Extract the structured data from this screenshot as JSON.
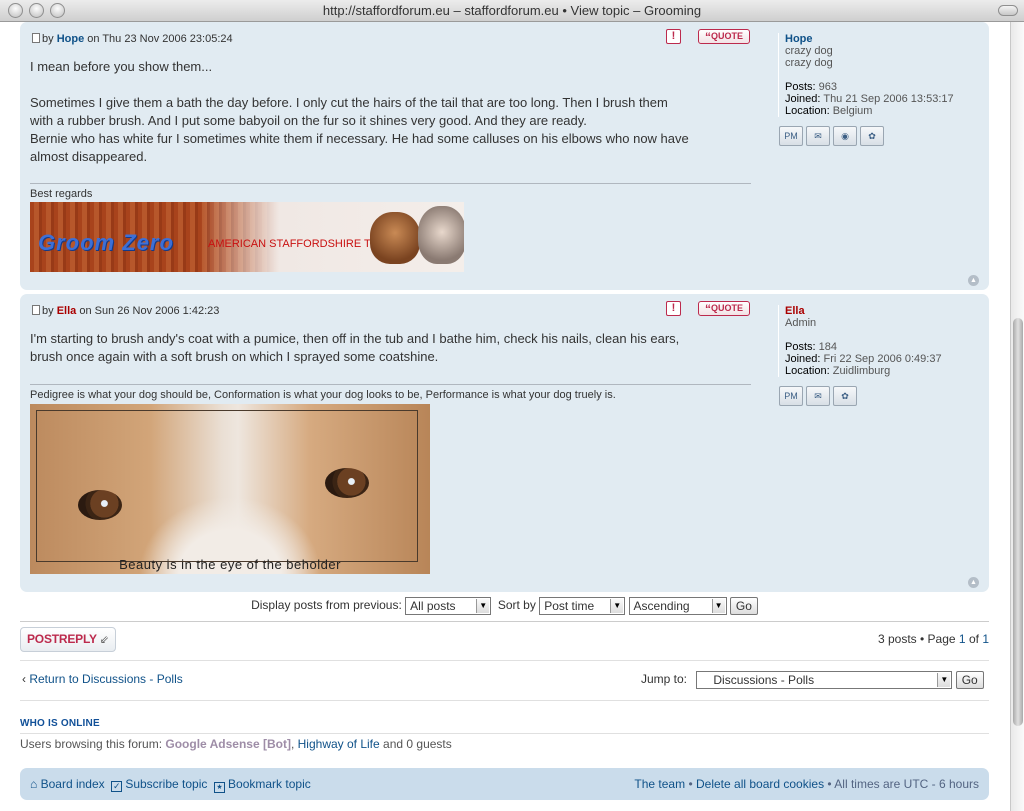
{
  "window": {
    "title": "http://staffordforum.eu – staffordforum.eu • View topic – Grooming"
  },
  "posts": [
    {
      "author_prefix": "by",
      "author": "Hope",
      "date": "on Thu 23 Nov 2006 23:05:24",
      "quote_label": "QUOTE",
      "report_label": "!",
      "content": [
        "I mean before you show them...",
        "",
        "Sometimes I give them a bath the day before. I only cut the hairs of the tail that are too long. Then I brush them",
        "with a rubber brush. And I put some babyoil on the fur so it shines very good. And they are ready.",
        "Bernie who has white fur I sometimes white them if necessary. He had some calluses on his elbows who now have",
        "almost disappeared."
      ],
      "signature_text": "Best regards",
      "banner_logo": "Groom Zero",
      "banner_kennel": "AMERICAN STAFFORDSHIRE TERRIER KENNEL",
      "profile": {
        "name": "Hope",
        "rank1": "crazy dog",
        "rank2": "crazy dog",
        "posts_label": "Posts:",
        "posts": "963",
        "joined_label": "Joined:",
        "joined": "Thu 21 Sep 2006 13:53:17",
        "location_label": "Location:",
        "location": "Belgium"
      }
    },
    {
      "author_prefix": "by",
      "author": "Ella",
      "date": "on Sun 26 Nov 2006 1:42:23",
      "quote_label": "QUOTE",
      "report_label": "!",
      "content": [
        "I'm starting to brush andy's coat with a pumice, then off in the tub and I bathe him, check his nails, clean his ears,",
        "brush once again with a soft brush on which I sprayed some coatshine."
      ],
      "signature_text": "Pedigree is what your dog should be, Conformation is what your dog looks to be, Performance is what your dog truely is.",
      "image_caption": "Beauty is in the eye of the beholder",
      "profile": {
        "name": "Ella",
        "rank1": "Admin",
        "posts_label": "Posts:",
        "posts": "184",
        "joined_label": "Joined:",
        "joined": "Fri 22 Sep 2006 0:49:37",
        "location_label": "Location:",
        "location": "Zuidlimburg"
      }
    }
  ],
  "profile_icons": {
    "pm": "PM",
    "email": "✉",
    "www": "◉",
    "icq": "✿"
  },
  "display": {
    "label": "Display posts from previous:",
    "range": "All posts",
    "sort_label": "Sort by",
    "sort": "Post time",
    "order": "Ascending",
    "go": "Go"
  },
  "postreply": {
    "label": "POSTREPLY",
    "icon": "⇙"
  },
  "pagination": {
    "posts": "3 posts",
    "page_prefix": "• Page",
    "current": "1",
    "of": "of",
    "total": "1"
  },
  "nav": {
    "return_icon": "‹",
    "return": "Return to Discussions - Polls",
    "jump_label": "Jump to:",
    "jump_value": "Discussions - Polls",
    "go": "Go"
  },
  "online": {
    "title": "WHO IS ONLINE",
    "prefix": "Users browsing this forum:",
    "bot": "Google Adsense [Bot]",
    "sep": ",",
    "user": "Highway of Life",
    "suffix": "and 0 guests"
  },
  "footer": {
    "board_index": "Board index",
    "subscribe": "Subscribe topic",
    "bookmark": "Bookmark topic",
    "team": "The team",
    "sep": "•",
    "delete_cookies": "Delete all board cookies",
    "timezone": "All times are UTC - 6 hours"
  },
  "colors": {
    "post_bg": "#e1ebf2",
    "link": "#105289",
    "admin": "#aa0000",
    "accent": "#bc2a4d",
    "footer_bg": "#cadceb"
  }
}
